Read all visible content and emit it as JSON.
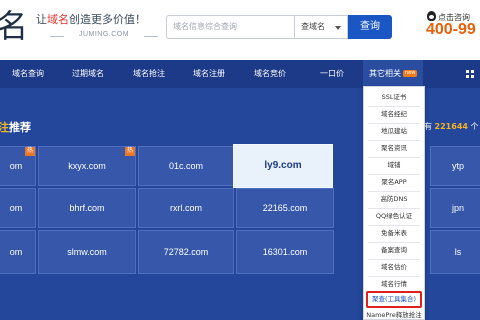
{
  "header": {
    "logo_char": "名",
    "slogan_pre": "让",
    "slogan_red": "域名",
    "slogan_post": "创造更多价值！",
    "domain": "JUMING.COM",
    "search_placeholder": "域名信息综合查询",
    "select_value": "查域名",
    "search_button": "查询",
    "qq_label": "点击咨询",
    "phone": "400-99"
  },
  "nav": {
    "items": [
      {
        "label": "域名查询"
      },
      {
        "label": "过期域名"
      },
      {
        "label": "域名抢注"
      },
      {
        "label": "域名注册"
      },
      {
        "label": "域名竞价"
      },
      {
        "label": "一口价"
      },
      {
        "label": "其它相关"
      }
    ],
    "hot_badge": "new"
  },
  "section": {
    "title_yellow": "注",
    "title_white": "推荐",
    "total_pre": "有",
    "total_num": "221644",
    "total_post": "个"
  },
  "grid": {
    "row1": [
      "om",
      "kxyx.com",
      "01c.com",
      "ly9.com",
      "ytp"
    ],
    "row2": [
      "om",
      "bhrf.com",
      "rxrl.com",
      "22165.com",
      "jpn"
    ],
    "row3": [
      "om",
      "slmw.com",
      "72782.com",
      "16301.com",
      "ls"
    ],
    "hot_tag": "热"
  },
  "dropdown": {
    "items": [
      "SSL证书",
      "域名经纪",
      "地瓜建站",
      "聚名资讯",
      "域铺",
      "聚名APP",
      "高防DNS",
      "QQ绿色认证",
      "免备米表",
      "备案查询",
      "域名估价",
      "域名行情",
      "聚查(工具集合)",
      "NamePre释放抢注"
    ]
  },
  "colors": {
    "nav_bg": "#1d3a88",
    "main_bg": "#24479b",
    "accent_orange": "#e8600a",
    "highlight_red": "#e0201c"
  }
}
